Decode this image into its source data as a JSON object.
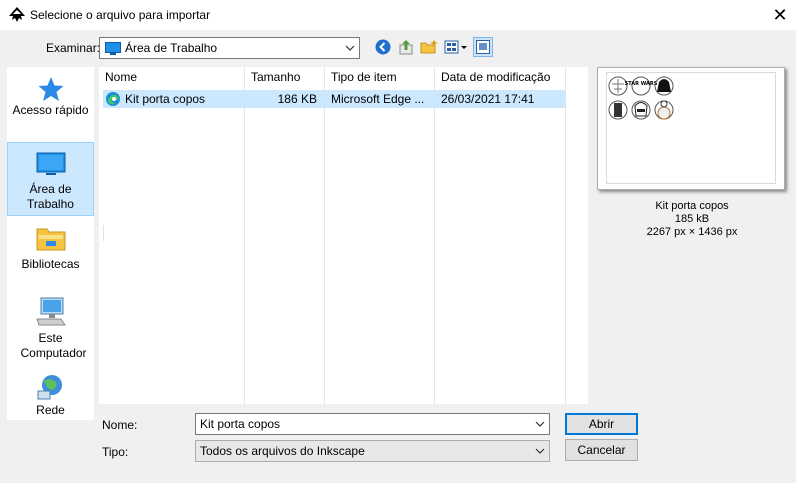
{
  "window": {
    "title": "Selecione o arquivo para importar",
    "close_glyph": "✕"
  },
  "toolbar": {
    "look_in_label": "Examinar:",
    "look_in_value": "Área de Trabalho",
    "icons": [
      "back-icon",
      "up-folder-icon",
      "new-folder-icon",
      "view-menu-icon",
      "preview-toggle-icon"
    ]
  },
  "sidebar": {
    "items": [
      {
        "label": "Acesso rápido",
        "icon": "star-icon"
      },
      {
        "label": "Área de Trabalho",
        "icon": "desktop-icon",
        "selected": true
      },
      {
        "label": "Bibliotecas",
        "icon": "libraries-icon"
      },
      {
        "label": "Este Computador",
        "icon": "computer-icon"
      },
      {
        "label": "Rede",
        "icon": "network-icon"
      }
    ]
  },
  "filelist": {
    "columns": [
      "Nome",
      "Tamanho",
      "Tipo de item",
      "Data de modificação"
    ],
    "rows": [
      {
        "name": "Kit porta copos",
        "size": "186 KB",
        "type": "Microsoft Edge ...",
        "date": "26/03/2021 17:41",
        "icon": "edge-icon"
      }
    ]
  },
  "preview": {
    "name": "Kit porta copos",
    "size": "185 kB",
    "dimensions": "2267 px × 1436 px",
    "artwork": {
      "stars_wars_text": "STAR WARS"
    }
  },
  "form": {
    "name_label": "Nome:",
    "name_value": "Kit porta copos",
    "type_label": "Tipo:",
    "type_value": "Todos os arquivos do Inkscape",
    "open_button": "Abrir",
    "cancel_button": "Cancelar"
  },
  "colors": {
    "selection": "#cce8ff",
    "accent": "#0078d7",
    "folder": "#f5c342"
  }
}
